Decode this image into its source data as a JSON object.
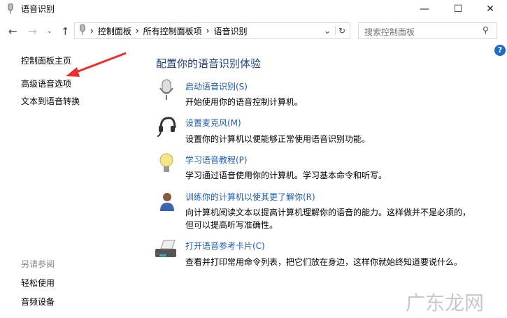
{
  "window": {
    "title": "语音识别",
    "minimize": "—",
    "maximize": "☐",
    "close": "✕"
  },
  "address": {
    "crumbs": [
      "控制面板",
      "所有控制面板项",
      "语音识别"
    ],
    "separator": "›"
  },
  "search": {
    "placeholder": "搜索控制面板"
  },
  "sidebar": {
    "items": [
      "控制面板主页",
      "高级语音选项",
      "文本到语音转换"
    ],
    "see_also_title": "另请参阅",
    "see_also": [
      "轻松使用",
      "音频设备"
    ]
  },
  "main": {
    "heading": "配置你的语音识别体验",
    "tasks": [
      {
        "link": "启动语音识别(S)",
        "desc": "开始使用你的语音控制计算机。",
        "icon": "microphone-icon"
      },
      {
        "link": "设置麦克风(M)",
        "desc": "设置你的计算机以便能够正常使用语音识别功能。",
        "icon": "headset-icon"
      },
      {
        "link": "学习语音教程(P)",
        "desc": "学习通过语音使用你的计算机。学习基本命令和听写。",
        "icon": "lightbulb-icon"
      },
      {
        "link": "训练你的计算机以使其更了解你(R)",
        "desc": "向计算机阅读文本以提高计算机理解你的语音的能力。这样做并不是必须的，但可以提高听写准确性。",
        "icon": "user-icon"
      },
      {
        "link": "打开语音参考卡片(C)",
        "desc": "查看并打印常用命令列表，把它们放在身边，这样你就始终知道要说什么。",
        "icon": "printer-icon"
      }
    ]
  },
  "watermark": "广东龙网",
  "colors": {
    "link": "#1e5db0",
    "arrow": "#e8322d"
  }
}
